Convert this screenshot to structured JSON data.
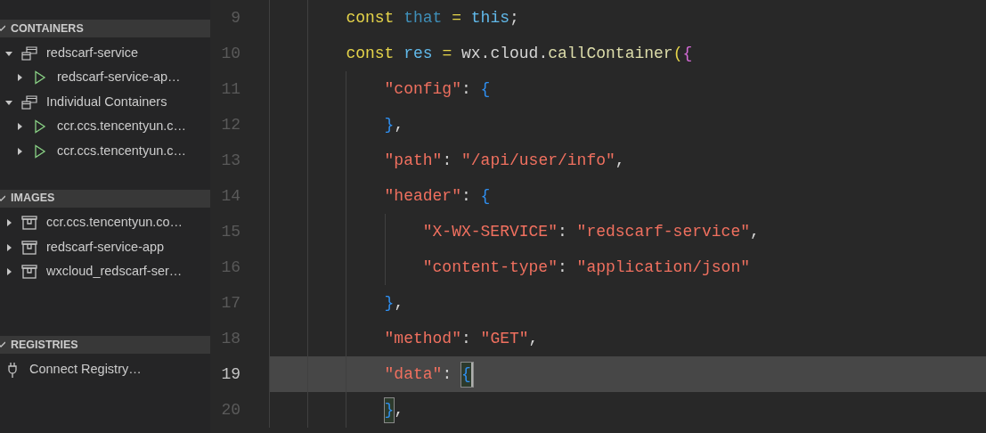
{
  "sidebar": {
    "sections": [
      {
        "title": "CONTAINERS",
        "expanded": true,
        "items": [
          {
            "label": "redscarf-service",
            "kind": "group",
            "expanded": true,
            "children": [
              {
                "label": "redscarf-service-ap…",
                "kind": "container",
                "expanded": false
              }
            ]
          },
          {
            "label": "Individual Containers",
            "kind": "group",
            "expanded": true,
            "children": [
              {
                "label": "ccr.ccs.tencentyun.c…",
                "kind": "container",
                "expanded": false
              },
              {
                "label": "ccr.ccs.tencentyun.c…",
                "kind": "container",
                "expanded": false
              }
            ]
          }
        ]
      },
      {
        "title": "IMAGES",
        "expanded": true,
        "items": [
          {
            "label": "ccr.ccs.tencentyun.co…",
            "kind": "image",
            "expanded": false
          },
          {
            "label": "redscarf-service-app",
            "kind": "image",
            "expanded": false
          },
          {
            "label": "wxcloud_redscarf-ser…",
            "kind": "image",
            "expanded": false
          }
        ]
      },
      {
        "title": "REGISTRIES",
        "expanded": true,
        "items": [
          {
            "label": "Connect Registry…",
            "kind": "plug"
          }
        ]
      }
    ]
  },
  "editor": {
    "lines": [
      {
        "number": "9",
        "current": false,
        "tokens": [
          {
            "kind": "keyword",
            "text": "const"
          },
          {
            "kind": "constant",
            "text": "that",
            "gap": true
          },
          {
            "kind": "keyword",
            "text": "=",
            "gap": true
          },
          {
            "kind": "variable",
            "text": "this",
            "gap": true
          },
          {
            "kind": "plain",
            "text": ";"
          }
        ]
      },
      {
        "number": "10",
        "current": false,
        "tokens": [
          {
            "kind": "keyword",
            "text": "const"
          },
          {
            "kind": "variable",
            "text": "res",
            "gap": true
          },
          {
            "kind": "keyword",
            "text": "=",
            "gap": true
          },
          {
            "kind": "plain",
            "text": "wx.cloud.",
            "gap": true
          },
          {
            "kind": "function",
            "text": "callContainer"
          },
          {
            "kind": "keyword",
            "text": "("
          },
          {
            "kind": "brace2",
            "text": "{"
          }
        ],
        "children": [
          {
            "number": "11",
            "current": false,
            "tokens": [
              {
                "kind": "string",
                "text": "\"config\""
              },
              {
                "kind": "plain",
                "text": ":"
              },
              {
                "kind": "brace",
                "text": "{",
                "gap": true
              }
            ]
          },
          {
            "number": "12",
            "current": false,
            "tokens": [
              {
                "kind": "brace",
                "text": "}"
              },
              {
                "kind": "plain",
                "text": ","
              }
            ]
          },
          {
            "number": "13",
            "current": false,
            "tokens": [
              {
                "kind": "string",
                "text": "\"path\""
              },
              {
                "kind": "plain",
                "text": ":"
              },
              {
                "kind": "string",
                "text": "\"/api/user/info\"",
                "gap": true
              },
              {
                "kind": "plain",
                "text": ","
              }
            ]
          },
          {
            "number": "14",
            "current": false,
            "tokens": [
              {
                "kind": "string",
                "text": "\"header\""
              },
              {
                "kind": "plain",
                "text": ":"
              },
              {
                "kind": "brace",
                "text": "{",
                "gap": true
              }
            ],
            "children": [
              {
                "number": "15",
                "current": false,
                "tokens": [
                  {
                    "kind": "string",
                    "text": "\"X-WX-SERVICE\""
                  },
                  {
                    "kind": "plain",
                    "text": ":"
                  },
                  {
                    "kind": "string",
                    "text": "\"redscarf-service\"",
                    "gap": true
                  },
                  {
                    "kind": "plain",
                    "text": ","
                  }
                ]
              },
              {
                "number": "16",
                "current": false,
                "tokens": [
                  {
                    "kind": "string",
                    "text": "\"content-type\""
                  },
                  {
                    "kind": "plain",
                    "text": ":"
                  },
                  {
                    "kind": "string",
                    "text": "\"application/json\"",
                    "gap": true
                  }
                ]
              }
            ]
          },
          {
            "number": "17",
            "current": false,
            "tokens": [
              {
                "kind": "brace",
                "text": "}"
              },
              {
                "kind": "plain",
                "text": ","
              }
            ]
          },
          {
            "number": "18",
            "current": false,
            "tokens": [
              {
                "kind": "string",
                "text": "\"method\""
              },
              {
                "kind": "plain",
                "text": ":"
              },
              {
                "kind": "string",
                "text": "\"GET\"",
                "gap": true
              },
              {
                "kind": "plain",
                "text": ","
              }
            ]
          },
          {
            "number": "19",
            "current": true,
            "tokens": [
              {
                "kind": "string",
                "text": "\"data\""
              },
              {
                "kind": "plain",
                "text": ":"
              },
              {
                "kind": "brace",
                "text": "{",
                "gap": true,
                "matched": true,
                "cursor": true
              }
            ]
          },
          {
            "number": "20",
            "current": false,
            "tokens": [
              {
                "kind": "brace",
                "text": "}",
                "matched": true
              },
              {
                "kind": "plain",
                "text": ","
              }
            ]
          }
        ]
      }
    ]
  }
}
